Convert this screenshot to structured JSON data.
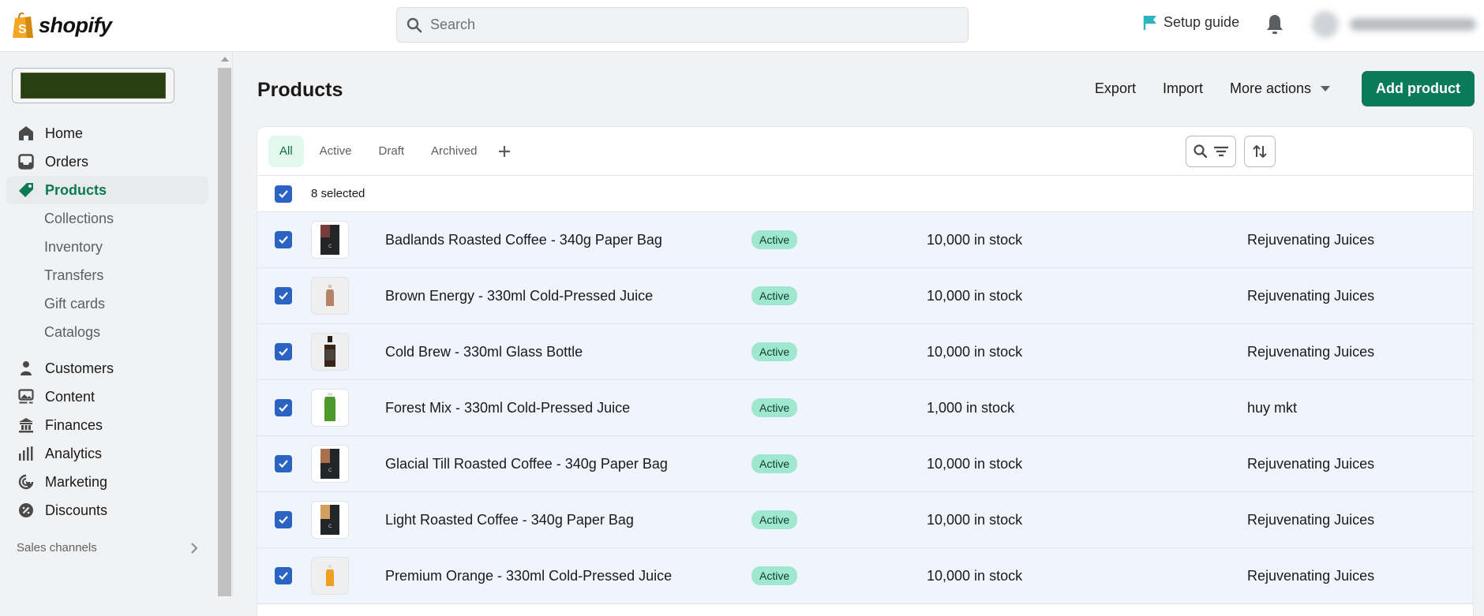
{
  "header": {
    "brand": "shopify",
    "search_placeholder": "Search",
    "setup_guide": "Setup guide",
    "colors": {
      "brand_green": "#0a7a5b",
      "setup_flag": "#2bb5c0",
      "logo_bag": "#f5a623"
    }
  },
  "sidebar": {
    "items": [
      {
        "label": "Home",
        "icon": "home-icon"
      },
      {
        "label": "Orders",
        "icon": "inbox-icon"
      },
      {
        "label": "Products",
        "icon": "tag-icon",
        "active": true
      }
    ],
    "sub_items": [
      "Collections",
      "Inventory",
      "Transfers",
      "Gift cards",
      "Catalogs"
    ],
    "items2": [
      {
        "label": "Customers",
        "icon": "person-icon"
      },
      {
        "label": "Content",
        "icon": "image-icon"
      },
      {
        "label": "Finances",
        "icon": "bank-icon"
      },
      {
        "label": "Analytics",
        "icon": "bar-chart-icon"
      },
      {
        "label": "Marketing",
        "icon": "target-icon"
      },
      {
        "label": "Discounts",
        "icon": "discount-icon"
      }
    ],
    "sales_channels": "Sales channels"
  },
  "page": {
    "title": "Products",
    "actions": {
      "export": "Export",
      "import": "Import",
      "more": "More actions",
      "add": "Add product"
    }
  },
  "tabs": [
    "All",
    "Active",
    "Draft",
    "Archived"
  ],
  "selection": {
    "label": "8 selected"
  },
  "products": [
    {
      "name": "Badlands Roasted Coffee - 340g Paper Bag",
      "status": "Active",
      "inventory": "10,000 in stock",
      "vendor": "Rejuvenating Juices",
      "thumb": "coffee-bag-red"
    },
    {
      "name": "Brown Energy - 330ml Cold-Pressed Juice",
      "status": "Active",
      "inventory": "10,000 in stock",
      "vendor": "Rejuvenating Juices",
      "thumb": "bottle-brown"
    },
    {
      "name": "Cold Brew - 330ml Glass Bottle",
      "status": "Active",
      "inventory": "10,000 in stock",
      "vendor": "Rejuvenating Juices",
      "thumb": "bottle-dark"
    },
    {
      "name": "Forest Mix - 330ml Cold-Pressed Juice",
      "status": "Active",
      "inventory": "1,000 in stock",
      "vendor": "huy mkt",
      "thumb": "bottle-green"
    },
    {
      "name": "Glacial Till Roasted Coffee - 340g Paper Bag",
      "status": "Active",
      "inventory": "10,000 in stock",
      "vendor": "Rejuvenating Juices",
      "thumb": "coffee-bag-copper"
    },
    {
      "name": "Light Roasted Coffee - 340g Paper Bag",
      "status": "Active",
      "inventory": "10,000 in stock",
      "vendor": "Rejuvenating Juices",
      "thumb": "coffee-bag-gold"
    },
    {
      "name": "Premium Orange - 330ml Cold-Pressed Juice",
      "status": "Active",
      "inventory": "10,000 in stock",
      "vendor": "Rejuvenating Juices",
      "thumb": "bottle-orange"
    }
  ]
}
